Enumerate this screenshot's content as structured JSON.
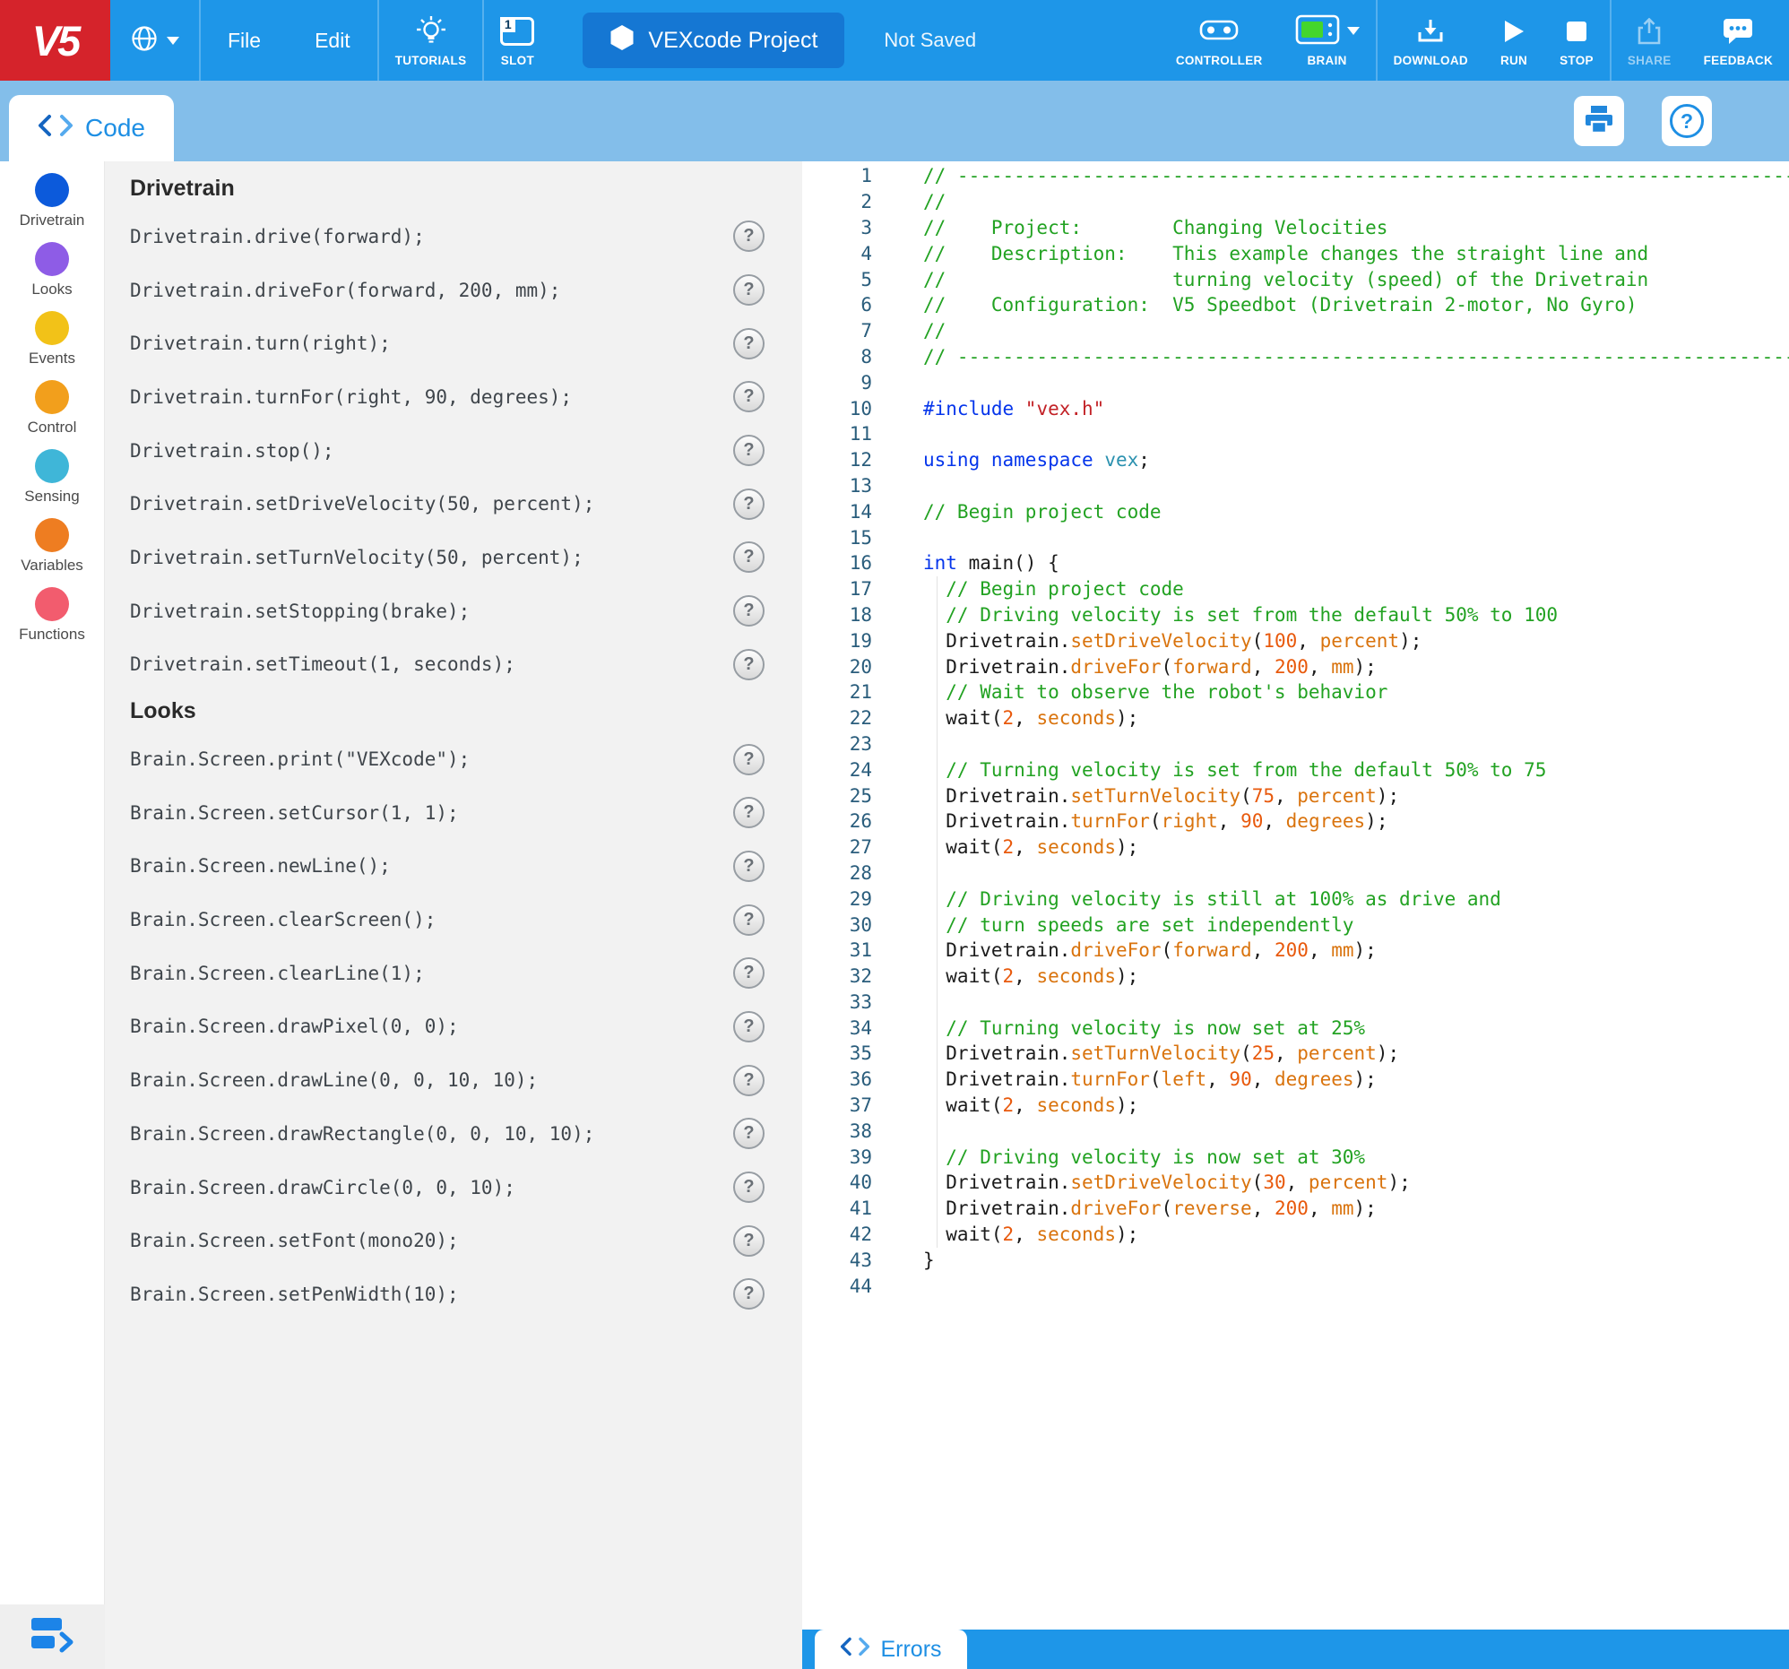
{
  "colors": {
    "brand_red": "#D5232B",
    "toolbar_blue": "#1E96E8",
    "project_box_blue": "#1577D3",
    "subbar_blue": "#83BEEA",
    "accent_blue": "#1E8FE4",
    "panel_gray": "#F2F2F2",
    "brain_green": "#44D62C",
    "comment_green": "#22A222",
    "keyword_blue": "#0535EB",
    "string_red": "#C22126",
    "ident_orange": "#D9730D",
    "number_orange": "#E8590C",
    "type_teal": "#2B91AF",
    "plain_text": "#1B1B1B",
    "gutter_blue": "#2A5D7C",
    "command_text": "#3F454B"
  },
  "topbar": {
    "logo_text": "V5",
    "menu_file": "File",
    "menu_edit": "Edit",
    "tutorials_label": "TUTORIALS",
    "slot_label": "SLOT",
    "slot_number": "1",
    "project_title": "VEXcode Project",
    "save_status": "Not Saved",
    "controller_label": "CONTROLLER",
    "brain_label": "BRAIN",
    "download_label": "DOWNLOAD",
    "run_label": "RUN",
    "stop_label": "STOP",
    "share_label": "SHARE",
    "feedback_label": "FEEDBACK"
  },
  "tabs": {
    "code_label": "Code",
    "errors_label": "Errors"
  },
  "icons": [
    "vex-logo",
    "globe-icon",
    "caret-down-icon",
    "lightbulb-icon",
    "slot-icon",
    "hexagon-icon",
    "controller-icon",
    "brain-icon",
    "download-icon",
    "run-icon",
    "stop-icon",
    "share-icon",
    "feedback-icon",
    "code-icon",
    "print-icon",
    "help-icon",
    "question-circle-icon",
    "blocks-toggle-icon",
    "errors-icon"
  ],
  "sidebar": {
    "categories": [
      {
        "label": "Drivetrain",
        "color": "#0C5ADB"
      },
      {
        "label": "Looks",
        "color": "#8E5CE6"
      },
      {
        "label": "Events",
        "color": "#F2C218"
      },
      {
        "label": "Control",
        "color": "#F29F1C"
      },
      {
        "label": "Sensing",
        "color": "#3FB6D8"
      },
      {
        "label": "Variables",
        "color": "#EE7D21"
      },
      {
        "label": "Functions",
        "color": "#F25C6E"
      }
    ]
  },
  "commands": {
    "help_symbol": "?",
    "sections": [
      {
        "title": "Drivetrain",
        "items": [
          "Drivetrain.drive(forward);",
          "Drivetrain.driveFor(forward, 200, mm);",
          "Drivetrain.turn(right);",
          "Drivetrain.turnFor(right, 90, degrees);",
          "Drivetrain.stop();",
          "Drivetrain.setDriveVelocity(50, percent);",
          "Drivetrain.setTurnVelocity(50, percent);",
          "Drivetrain.setStopping(brake);",
          "Drivetrain.setTimeout(1, seconds);"
        ]
      },
      {
        "title": "Looks",
        "items": [
          "Brain.Screen.print(\"VEXcode\");",
          "Brain.Screen.setCursor(1, 1);",
          "Brain.Screen.newLine();",
          "Brain.Screen.clearScreen();",
          "Brain.Screen.clearLine(1);",
          "Brain.Screen.drawPixel(0, 0);",
          "Brain.Screen.drawLine(0, 0, 10, 10);",
          "Brain.Screen.drawRectangle(0, 0, 10, 10);",
          "Brain.Screen.drawCircle(0, 0, 10);",
          "Brain.Screen.setFont(mono20);",
          "Brain.Screen.setPenWidth(10);"
        ]
      }
    ]
  },
  "editor": {
    "line_count": 44,
    "lines": [
      [
        [
          "c",
          "// ----------------------------------------------------------------------------------------------"
        ]
      ],
      [
        [
          "c",
          "//"
        ]
      ],
      [
        [
          "c",
          "//    Project:        Changing Velocities"
        ]
      ],
      [
        [
          "c",
          "//    Description:    This example changes the straight line and"
        ]
      ],
      [
        [
          "c",
          "//                    turning velocity (speed) of the Drivetrain"
        ]
      ],
      [
        [
          "c",
          "//    Configuration:  V5 Speedbot (Drivetrain 2-motor, No Gyro)"
        ]
      ],
      [
        [
          "c",
          "//"
        ]
      ],
      [
        [
          "c",
          "// ----------------------------------------------------------------------------------------------"
        ]
      ],
      [],
      [
        [
          "k",
          "#include "
        ],
        [
          "s",
          "\"vex.h\""
        ]
      ],
      [],
      [
        [
          "k",
          "using"
        ],
        [
          "p",
          " "
        ],
        [
          "k",
          "namespace"
        ],
        [
          "p",
          " "
        ],
        [
          "t",
          "vex"
        ],
        [
          "p",
          ";"
        ]
      ],
      [],
      [
        [
          "c",
          "// Begin project code"
        ]
      ],
      [],
      [
        [
          "k",
          "int"
        ],
        [
          "p",
          " main() {"
        ]
      ],
      [
        [
          "c",
          "  // Begin project code"
        ]
      ],
      [
        [
          "c",
          "  // Driving velocity is set from the default 50% to 100"
        ]
      ],
      [
        [
          "p",
          "  Drivetrain."
        ],
        [
          "o",
          "setDriveVelocity"
        ],
        [
          "p",
          "("
        ],
        [
          "n",
          "100"
        ],
        [
          "p",
          ", "
        ],
        [
          "o",
          "percent"
        ],
        [
          "p",
          ");"
        ]
      ],
      [
        [
          "p",
          "  Drivetrain."
        ],
        [
          "o",
          "driveFor"
        ],
        [
          "p",
          "("
        ],
        [
          "o",
          "forward"
        ],
        [
          "p",
          ", "
        ],
        [
          "n",
          "200"
        ],
        [
          "p",
          ", "
        ],
        [
          "o",
          "mm"
        ],
        [
          "p",
          ");"
        ]
      ],
      [
        [
          "c",
          "  // Wait to observe the robot's behavior"
        ]
      ],
      [
        [
          "p",
          "  wait("
        ],
        [
          "n",
          "2"
        ],
        [
          "p",
          ", "
        ],
        [
          "o",
          "seconds"
        ],
        [
          "p",
          ");"
        ]
      ],
      [],
      [
        [
          "c",
          "  // Turning velocity is set from the default 50% to 75"
        ]
      ],
      [
        [
          "p",
          "  Drivetrain."
        ],
        [
          "o",
          "setTurnVelocity"
        ],
        [
          "p",
          "("
        ],
        [
          "n",
          "75"
        ],
        [
          "p",
          ", "
        ],
        [
          "o",
          "percent"
        ],
        [
          "p",
          ");"
        ]
      ],
      [
        [
          "p",
          "  Drivetrain."
        ],
        [
          "o",
          "turnFor"
        ],
        [
          "p",
          "("
        ],
        [
          "o",
          "right"
        ],
        [
          "p",
          ", "
        ],
        [
          "n",
          "90"
        ],
        [
          "p",
          ", "
        ],
        [
          "o",
          "degrees"
        ],
        [
          "p",
          ");"
        ]
      ],
      [
        [
          "p",
          "  wait("
        ],
        [
          "n",
          "2"
        ],
        [
          "p",
          ", "
        ],
        [
          "o",
          "seconds"
        ],
        [
          "p",
          ");"
        ]
      ],
      [],
      [
        [
          "c",
          "  // Driving velocity is still at 100% as drive and"
        ]
      ],
      [
        [
          "c",
          "  // turn speeds are set independently"
        ]
      ],
      [
        [
          "p",
          "  Drivetrain."
        ],
        [
          "o",
          "driveFor"
        ],
        [
          "p",
          "("
        ],
        [
          "o",
          "forward"
        ],
        [
          "p",
          ", "
        ],
        [
          "n",
          "200"
        ],
        [
          "p",
          ", "
        ],
        [
          "o",
          "mm"
        ],
        [
          "p",
          ");"
        ]
      ],
      [
        [
          "p",
          "  wait("
        ],
        [
          "n",
          "2"
        ],
        [
          "p",
          ", "
        ],
        [
          "o",
          "seconds"
        ],
        [
          "p",
          ");"
        ]
      ],
      [],
      [
        [
          "c",
          "  // Turning velocity is now set at 25%"
        ]
      ],
      [
        [
          "p",
          "  Drivetrain."
        ],
        [
          "o",
          "setTurnVelocity"
        ],
        [
          "p",
          "("
        ],
        [
          "n",
          "25"
        ],
        [
          "p",
          ", "
        ],
        [
          "o",
          "percent"
        ],
        [
          "p",
          ");"
        ]
      ],
      [
        [
          "p",
          "  Drivetrain."
        ],
        [
          "o",
          "turnFor"
        ],
        [
          "p",
          "("
        ],
        [
          "o",
          "left"
        ],
        [
          "p",
          ", "
        ],
        [
          "n",
          "90"
        ],
        [
          "p",
          ", "
        ],
        [
          "o",
          "degrees"
        ],
        [
          "p",
          ");"
        ]
      ],
      [
        [
          "p",
          "  wait("
        ],
        [
          "n",
          "2"
        ],
        [
          "p",
          ", "
        ],
        [
          "o",
          "seconds"
        ],
        [
          "p",
          ");"
        ]
      ],
      [],
      [
        [
          "c",
          "  // Driving velocity is now set at 30%"
        ]
      ],
      [
        [
          "p",
          "  Drivetrain."
        ],
        [
          "o",
          "setDriveVelocity"
        ],
        [
          "p",
          "("
        ],
        [
          "n",
          "30"
        ],
        [
          "p",
          ", "
        ],
        [
          "o",
          "percent"
        ],
        [
          "p",
          ");"
        ]
      ],
      [
        [
          "p",
          "  Drivetrain."
        ],
        [
          "o",
          "driveFor"
        ],
        [
          "p",
          "("
        ],
        [
          "o",
          "reverse"
        ],
        [
          "p",
          ", "
        ],
        [
          "n",
          "200"
        ],
        [
          "p",
          ", "
        ],
        [
          "o",
          "mm"
        ],
        [
          "p",
          ");"
        ]
      ],
      [
        [
          "p",
          "  wait("
        ],
        [
          "n",
          "2"
        ],
        [
          "p",
          ", "
        ],
        [
          "o",
          "seconds"
        ],
        [
          "p",
          ");"
        ]
      ],
      [
        [
          "p",
          "}"
        ]
      ],
      []
    ]
  }
}
